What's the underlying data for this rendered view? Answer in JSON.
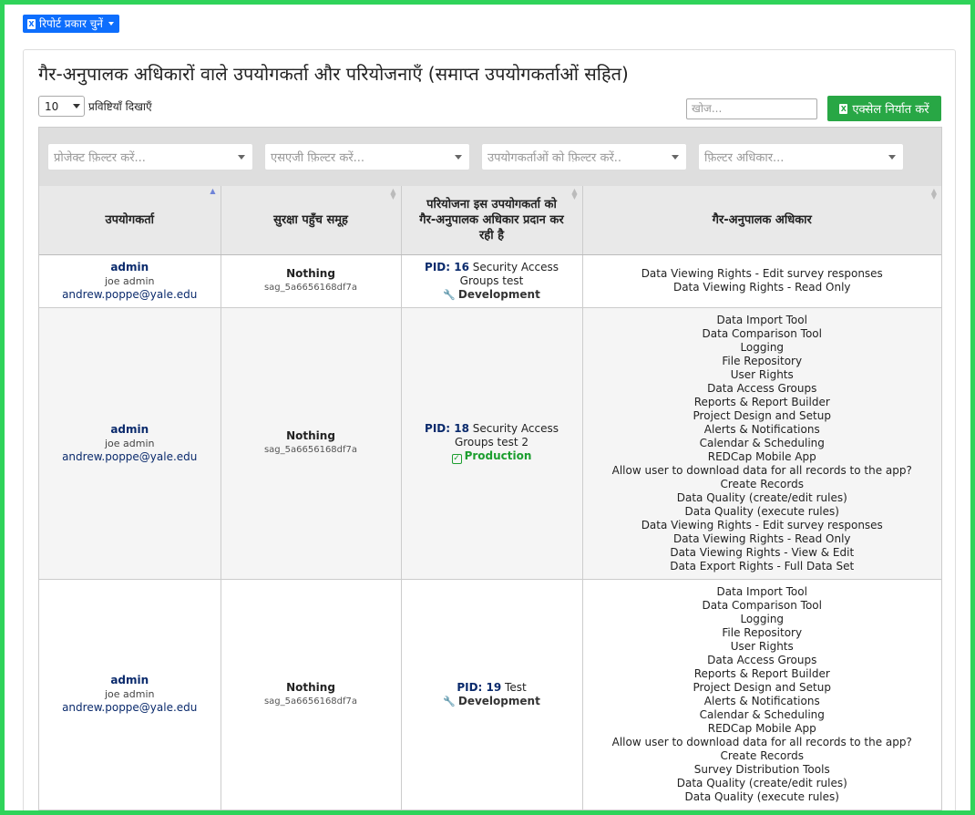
{
  "report_button": {
    "label": "रिपोर्ट प्रकार चुनें"
  },
  "title": "गैर-अनुपालक अधिकारों वाले उपयोगकर्ता और परियोजनाएँ (समाप्त उपयोगकर्ताओं सहित)",
  "length": {
    "value": "10",
    "label": "प्रविष्टियाँ दिखाएँ"
  },
  "search": {
    "placeholder": "खोज..."
  },
  "export": {
    "label": "एक्सेल निर्यात करें"
  },
  "filters": [
    "प्रोजेक्ट फ़िल्टर करें...",
    "एसएजी फ़िल्टर करें...",
    "उपयोगकर्ताओं को फ़िल्टर करें..",
    "फ़िल्टर अधिकार..."
  ],
  "columns": [
    "उपयोगकर्ता",
    "सुरक्षा पहुँच समूह",
    "परियोजना इस उपयोगकर्ता को गैर-अनुपालक अधिकार प्रदान कर रही है",
    "गैर-अनुपालक अधिकार"
  ],
  "rows": [
    {
      "user": {
        "name": "admin",
        "full": "joe admin",
        "email": "andrew.poppe@yale.edu"
      },
      "sag": {
        "name": "Nothing",
        "id": "sag_5a6656168df7a"
      },
      "project": {
        "pid_label": "PID: 16",
        "name": "Security Access Groups test",
        "status": "Development",
        "status_icon": "wrench-icon"
      },
      "rights": [
        "Data Viewing Rights - Edit survey responses",
        "Data Viewing Rights - Read Only"
      ]
    },
    {
      "user": {
        "name": "admin",
        "full": "joe admin",
        "email": "andrew.poppe@yale.edu"
      },
      "sag": {
        "name": "Nothing",
        "id": "sag_5a6656168df7a"
      },
      "project": {
        "pid_label": "PID: 18",
        "name": "Security Access Groups test 2",
        "status": "Production",
        "status_icon": "check-square-icon"
      },
      "rights": [
        "Data Import Tool",
        "Data Comparison Tool",
        "Logging",
        "File Repository",
        "User Rights",
        "Data Access Groups",
        "Reports & Report Builder",
        "Project Design and Setup",
        "Alerts & Notifications",
        "Calendar & Scheduling",
        "REDCap Mobile App",
        "Allow user to download data for all records to the app?",
        "Create Records",
        "Data Quality (create/edit rules)",
        "Data Quality (execute rules)",
        "Data Viewing Rights - Edit survey responses",
        "Data Viewing Rights - Read Only",
        "Data Viewing Rights - View & Edit",
        "Data Export Rights - Full Data Set"
      ]
    },
    {
      "user": {
        "name": "admin",
        "full": "joe admin",
        "email": "andrew.poppe@yale.edu"
      },
      "sag": {
        "name": "Nothing",
        "id": "sag_5a6656168df7a"
      },
      "project": {
        "pid_label": "PID: 19",
        "name": "Test",
        "status": "Development",
        "status_icon": "wrench-icon"
      },
      "rights": [
        "Data Import Tool",
        "Data Comparison Tool",
        "Logging",
        "File Repository",
        "User Rights",
        "Data Access Groups",
        "Reports & Report Builder",
        "Project Design and Setup",
        "Alerts & Notifications",
        "Calendar & Scheduling",
        "REDCap Mobile App",
        "Allow user to download data for all records to the app?",
        "Create Records",
        "Survey Distribution Tools",
        "Data Quality (create/edit rules)",
        "Data Quality (execute rules)"
      ]
    }
  ],
  "colors": {
    "primary": "#0d6efd",
    "success": "#28a745",
    "frame": "#2fd35a",
    "link": "#0a2a6c"
  }
}
